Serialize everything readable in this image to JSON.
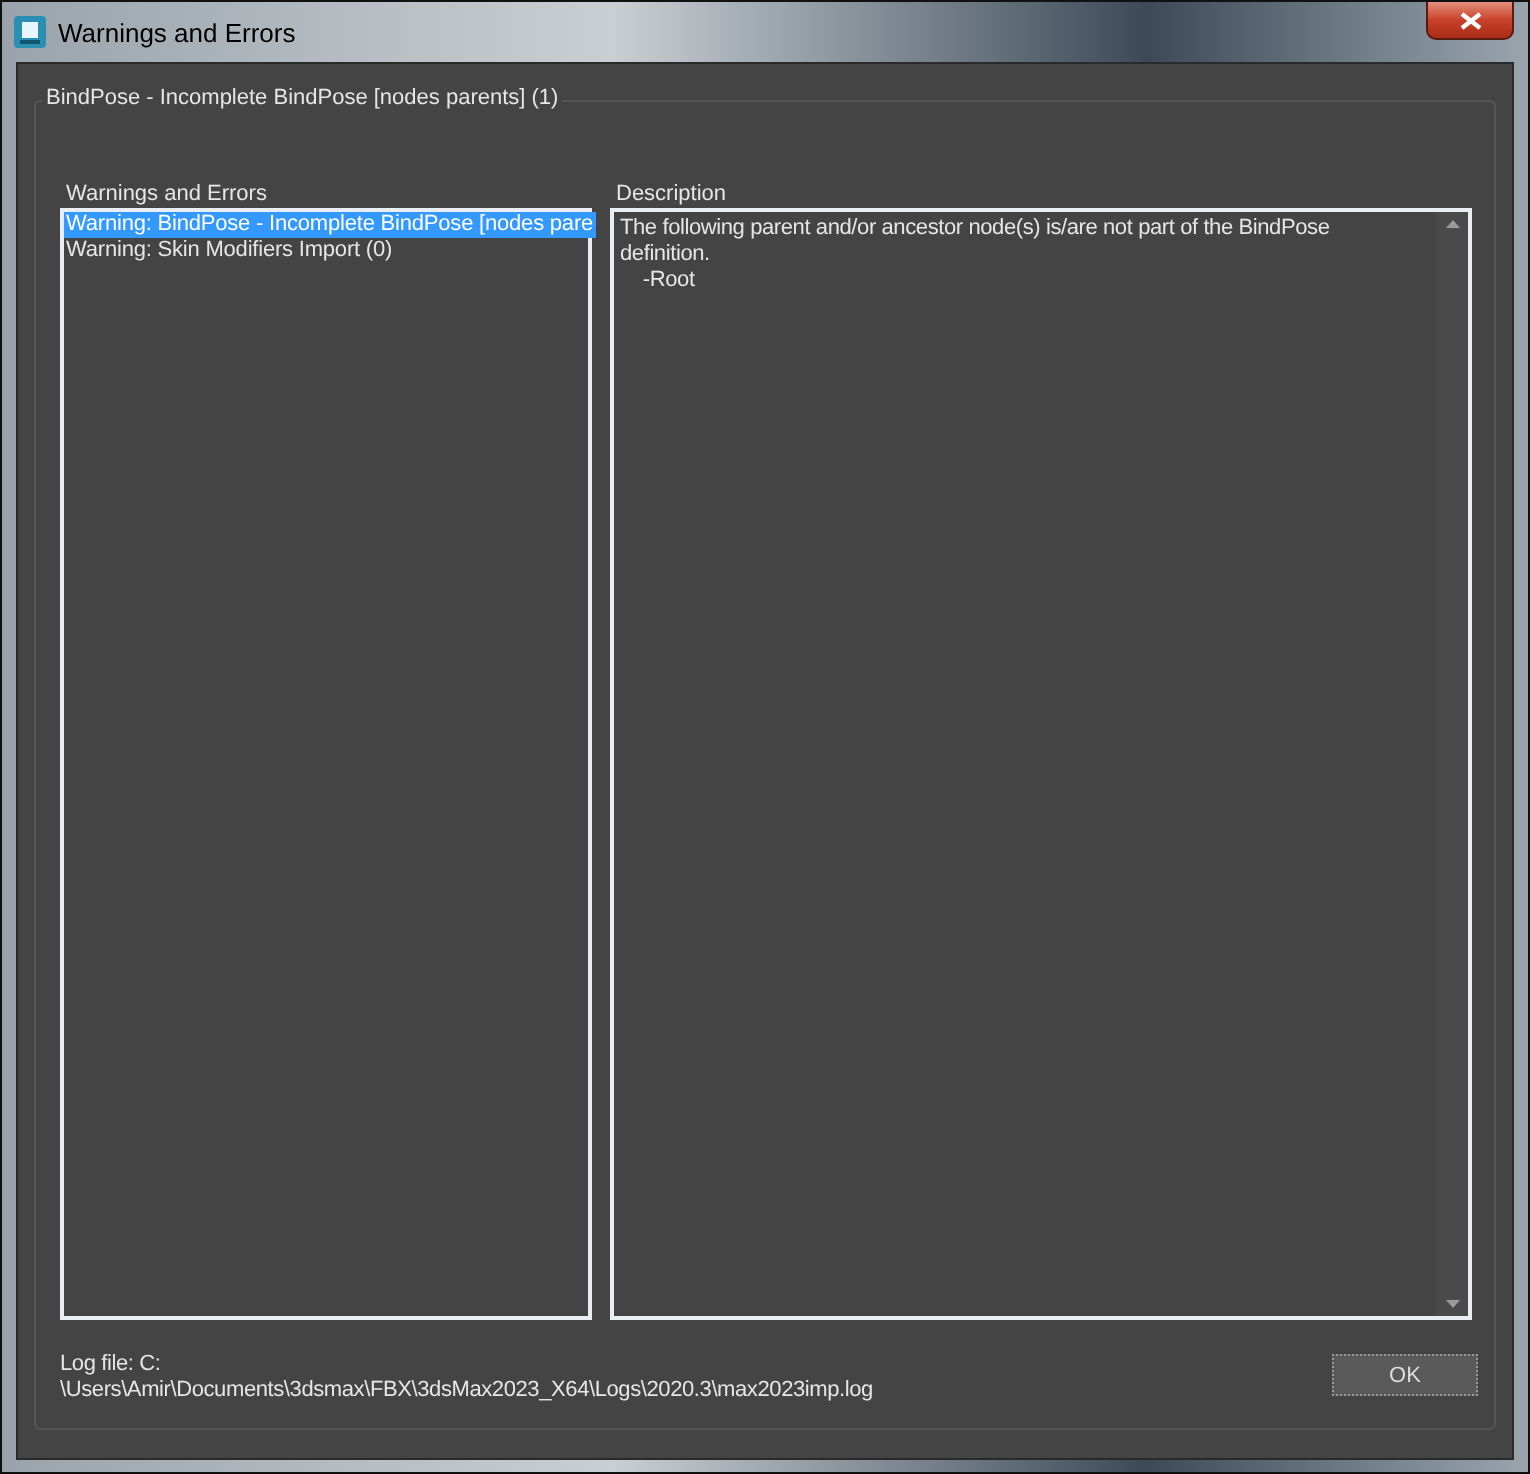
{
  "window": {
    "title": "Warnings and Errors"
  },
  "group": {
    "title": "BindPose - Incomplete BindPose [nodes parents] (1)"
  },
  "warnings": {
    "label": "Warnings and Errors",
    "items": [
      {
        "text": "Warning: BindPose - Incomplete BindPose [nodes pare",
        "selected": true
      },
      {
        "text": "Warning: Skin Modifiers Import (0)",
        "selected": false
      }
    ]
  },
  "description": {
    "label": "Description",
    "lines": [
      "The following parent and/or ancestor node(s) is/are not part of the BindPose",
      "definition.",
      "    -Root"
    ]
  },
  "log": {
    "lines": [
      "Log file: C:",
      "\\Users\\Amir\\Documents\\3dsmax\\FBX\\3dsMax2023_X64\\Logs\\2020.3\\max2023imp.log"
    ]
  },
  "buttons": [
    "OK"
  ]
}
